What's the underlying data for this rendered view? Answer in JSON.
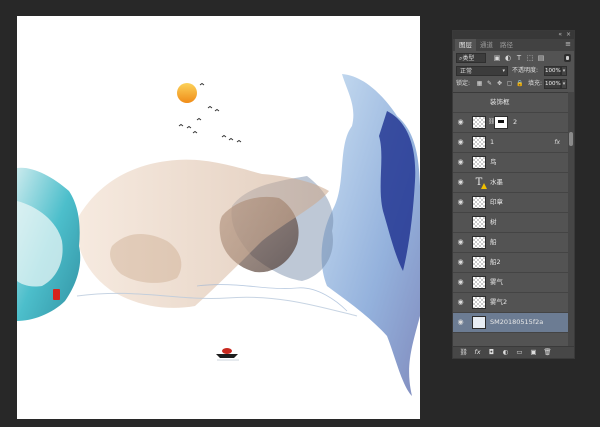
{
  "canvas": {
    "seal_text": "印",
    "colors": {
      "background": "#ffffff",
      "sun": "#f4a72a",
      "teal": "#1aa8b8",
      "blue": "#1c3fa0",
      "beige": "#d9b79b",
      "brown": "#6b4a3a",
      "seal_red": "#d8231a"
    }
  },
  "panel": {
    "header_icons": {
      "collapse": "«",
      "close": "×"
    },
    "tabs": [
      "图层",
      "通道",
      "路径"
    ],
    "active_tab": "图层",
    "menu_icon": "≡",
    "filter": {
      "kind_label": "类型",
      "kind_icon": "search-icon",
      "icons": [
        "image-filter-icon",
        "adjustment-filter-icon",
        "type-filter-icon",
        "shape-filter-icon",
        "smartobject-filter-icon"
      ]
    },
    "blend_mode": "正常",
    "opacity_label": "不透明度:",
    "opacity_value": "100%",
    "lock_label": "锁定:",
    "fill_label": "填充:",
    "fill_value": "100%",
    "layers": [
      {
        "name": "装饰框",
        "visible": false,
        "thumb": "transparent"
      },
      {
        "name": "2",
        "visible": true,
        "thumb": "transparent",
        "mask": true
      },
      {
        "name": "1",
        "visible": true,
        "thumb": "transparent",
        "fx": "fx"
      },
      {
        "name": "鸟",
        "visible": true,
        "thumb": "transparent"
      },
      {
        "name": "水墨",
        "visible": true,
        "thumb": "text",
        "warning": true
      },
      {
        "name": "印章",
        "visible": true,
        "thumb": "transparent"
      },
      {
        "name": "树",
        "visible": false,
        "thumb": "transparent"
      },
      {
        "name": "船",
        "visible": true,
        "thumb": "transparent"
      },
      {
        "name": "船2",
        "visible": true,
        "thumb": "transparent"
      },
      {
        "name": "雾气",
        "visible": true,
        "thumb": "transparent"
      },
      {
        "name": "雾气2",
        "visible": true,
        "thumb": "transparent"
      },
      {
        "name": "SM20180515f2a",
        "visible": true,
        "thumb": "image",
        "selected": true
      }
    ],
    "bottom_icons": [
      "link-icon",
      "fx-icon",
      "add-mask-icon",
      "adjustment-layer-icon",
      "group-icon",
      "new-layer-icon",
      "delete-icon"
    ],
    "bottom_glyphs": [
      "⛓",
      "fx",
      "◘",
      "◐",
      "▭",
      "▣",
      "🗑"
    ]
  }
}
